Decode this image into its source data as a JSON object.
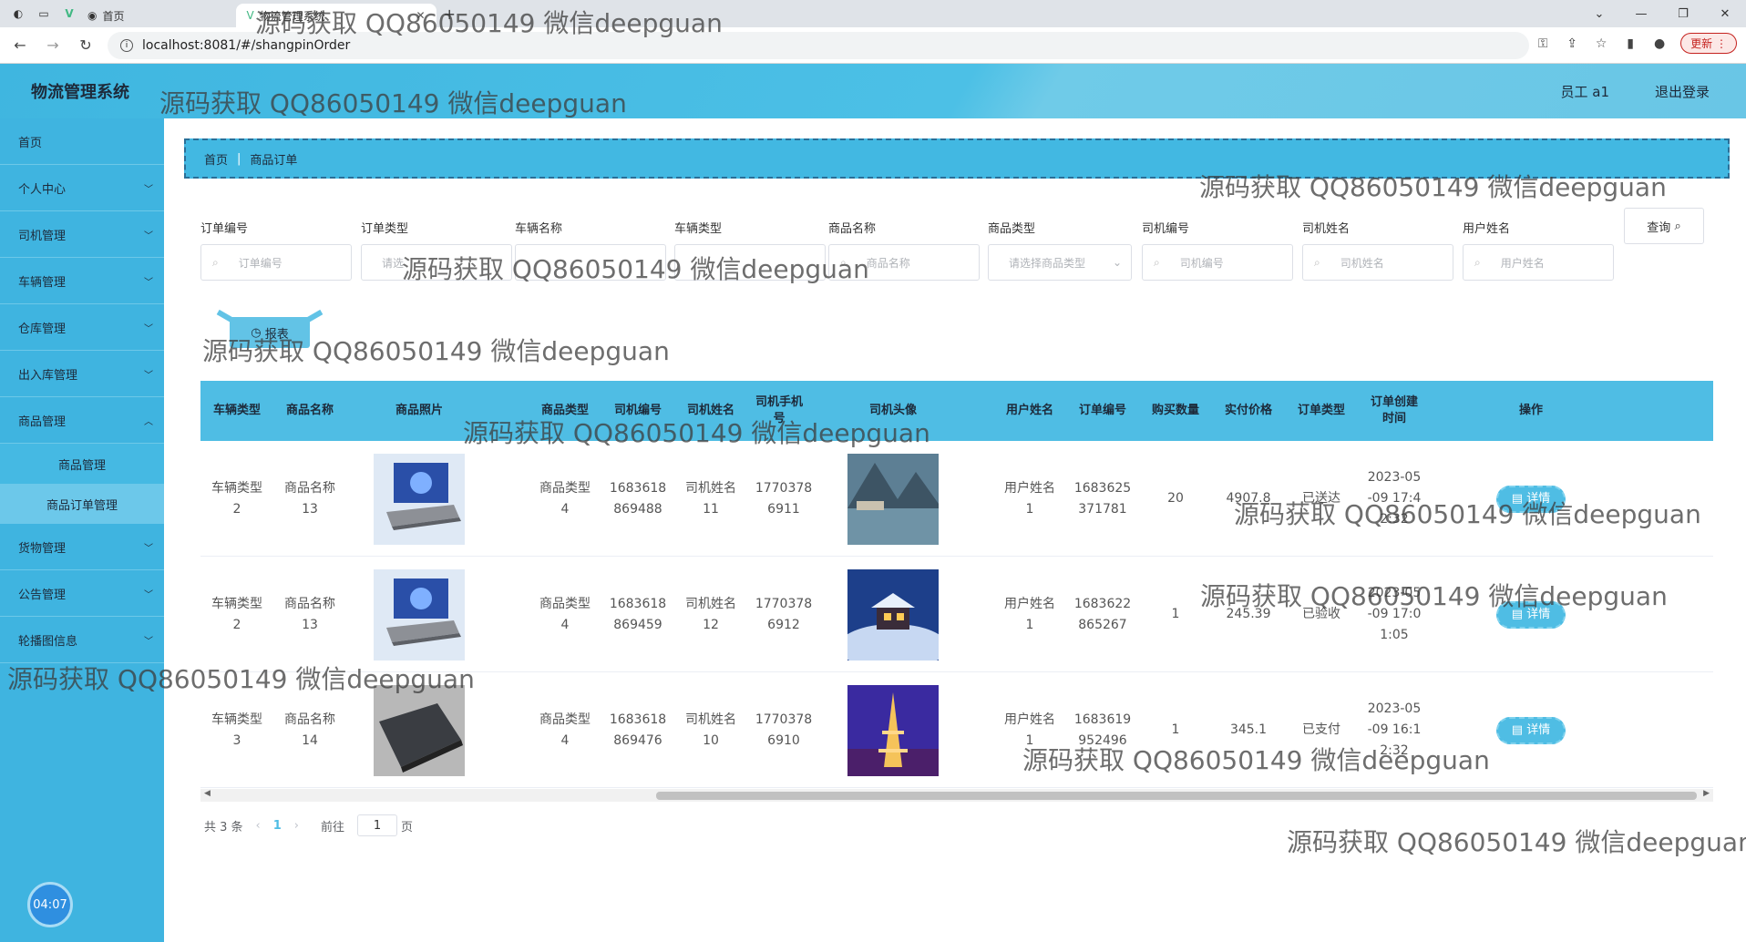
{
  "browser": {
    "tabs": [
      {
        "title": "首页"
      },
      {
        "title": "物流管理系统"
      }
    ],
    "url": "localhost:8081/#/shangpinOrder",
    "update_label": "更新"
  },
  "app": {
    "title": "物流管理系统",
    "user": "员工 a1",
    "logout": "退出登录"
  },
  "sidebar": {
    "items": [
      {
        "label": "首页"
      },
      {
        "label": "个人中心"
      },
      {
        "label": "司机管理"
      },
      {
        "label": "车辆管理"
      },
      {
        "label": "仓库管理"
      },
      {
        "label": "出入库管理"
      },
      {
        "label": "商品管理"
      }
    ],
    "subitems": [
      {
        "label": "商品管理"
      },
      {
        "label": "商品订单管理"
      }
    ],
    "items2": [
      {
        "label": "货物管理"
      },
      {
        "label": "公告管理"
      },
      {
        "label": "轮播图信息"
      }
    ],
    "timer": "04:07"
  },
  "breadcrumb": {
    "home": "首页",
    "current": "商品订单"
  },
  "filters": [
    {
      "label": "订单编号",
      "placeholder": "订单编号"
    },
    {
      "label": "订单类型",
      "placeholder": "请选"
    },
    {
      "label": "车辆名称",
      "placeholder": ""
    },
    {
      "label": "车辆类型",
      "placeholder": ""
    },
    {
      "label": "商品名称",
      "placeholder": "商品名称"
    },
    {
      "label": "商品类型",
      "placeholder": "请选择商品类型"
    },
    {
      "label": "司机编号",
      "placeholder": "司机编号"
    },
    {
      "label": "司机姓名",
      "placeholder": "司机姓名"
    },
    {
      "label": "用户姓名",
      "placeholder": "用户姓名"
    }
  ],
  "query_label": "查询",
  "report_label": "报表",
  "table": {
    "headers": [
      "车辆类型",
      "商品名称",
      "商品照片",
      "商品类型",
      "司机编号",
      "司机姓名",
      "司机手机号",
      "司机头像",
      "用户姓名",
      "订单编号",
      "购买数量",
      "实付价格",
      "订单类型",
      "订单创建时间",
      "操作"
    ],
    "rows": [
      {
        "car_type": [
          "车辆类型",
          "2"
        ],
        "product": [
          "商品名称",
          "13"
        ],
        "ptype": [
          "商品类型",
          "4"
        ],
        "driver_no": [
          "1683618",
          "869488"
        ],
        "driver_name": [
          "司机姓名",
          "11"
        ],
        "phone": [
          "1770378",
          "6911"
        ],
        "user": [
          "用户姓名",
          "1"
        ],
        "order_no": [
          "1683625",
          "371781"
        ],
        "qty": "20",
        "price": "4907.8",
        "otype": "已送达",
        "time": [
          "2023-05",
          "-09 17:4",
          "2:32"
        ],
        "action": "详情"
      },
      {
        "car_type": [
          "车辆类型",
          "2"
        ],
        "product": [
          "商品名称",
          "13"
        ],
        "ptype": [
          "商品类型",
          "4"
        ],
        "driver_no": [
          "1683618",
          "869459"
        ],
        "driver_name": [
          "司机姓名",
          "12"
        ],
        "phone": [
          "1770378",
          "6912"
        ],
        "user": [
          "用户姓名",
          "1"
        ],
        "order_no": [
          "1683622",
          "865267"
        ],
        "qty": "1",
        "price": "245.39",
        "otype": "已验收",
        "time": [
          "2023-05",
          "-09 17:0",
          "1:05"
        ],
        "action": "详情"
      },
      {
        "car_type": [
          "车辆类型",
          "3"
        ],
        "product": [
          "商品名称",
          "14"
        ],
        "ptype": [
          "商品类型",
          "4"
        ],
        "driver_no": [
          "1683618",
          "869476"
        ],
        "driver_name": [
          "司机姓名",
          "10"
        ],
        "phone": [
          "1770378",
          "6910"
        ],
        "user": [
          "用户姓名",
          "1"
        ],
        "order_no": [
          "1683619",
          "952496"
        ],
        "qty": "1",
        "price": "345.1",
        "otype": "已支付",
        "time": [
          "2023-05",
          "-09 16:1",
          "2:32"
        ],
        "action": "详情"
      }
    ]
  },
  "pager": {
    "total": "共 3 条",
    "page": "1",
    "goto": "前往",
    "goto_val": "1",
    "page_unit": "页"
  },
  "watermark": "源码获取 QQ86050149 微信deepguan"
}
